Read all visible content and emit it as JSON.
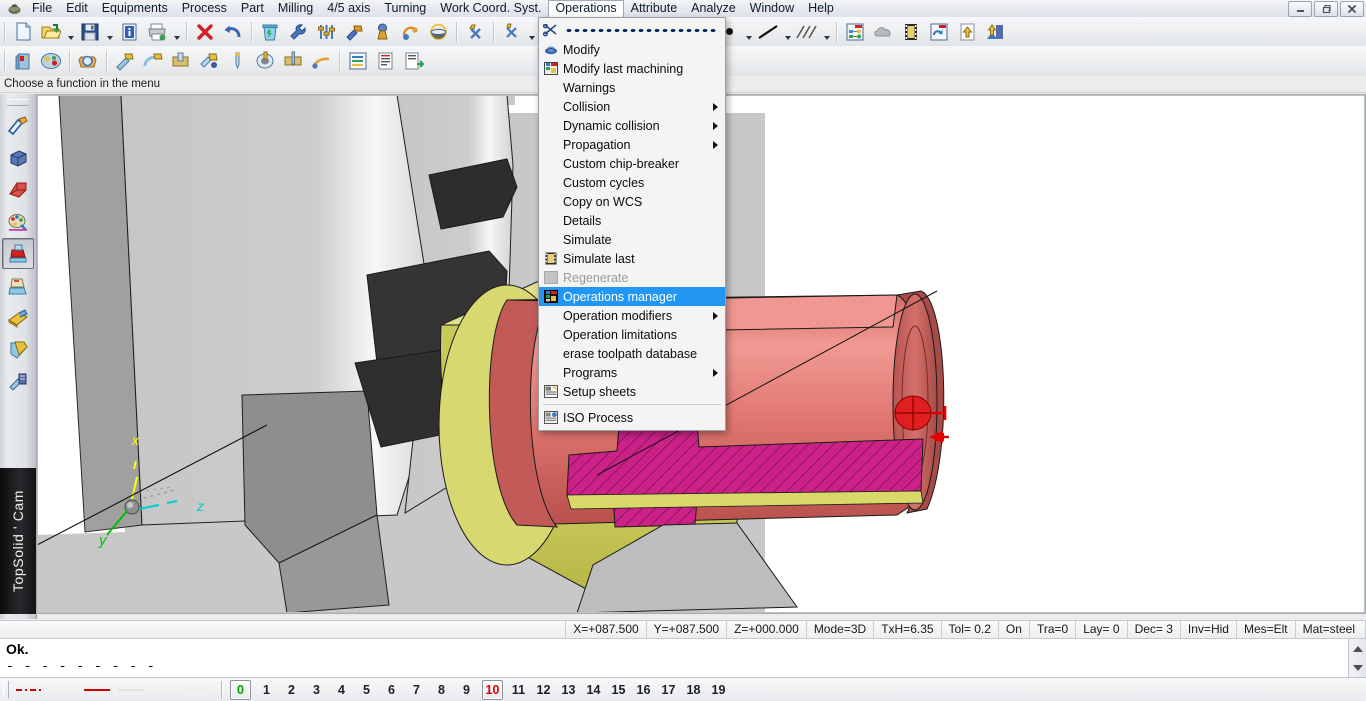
{
  "window": {
    "app_icon": "topsolid-app-icon",
    "controls": [
      {
        "name": "minimize-button",
        "glyph": "–"
      },
      {
        "name": "restore-button",
        "glyph": "❐"
      },
      {
        "name": "close-button",
        "glyph": "✕"
      }
    ]
  },
  "menubar": {
    "items": [
      {
        "label": "File",
        "open": false
      },
      {
        "label": "Edit",
        "open": false
      },
      {
        "label": "Equipments",
        "open": false
      },
      {
        "label": "Process",
        "open": false
      },
      {
        "label": "Part",
        "open": false
      },
      {
        "label": "Milling",
        "open": false
      },
      {
        "label": "4/5 axis",
        "open": false
      },
      {
        "label": "Turning",
        "open": false
      },
      {
        "label": "Work Coord. Syst.",
        "open": false
      },
      {
        "label": "Operations",
        "open": true
      },
      {
        "label": "Attribute",
        "open": false
      },
      {
        "label": "Analyze",
        "open": false
      },
      {
        "label": "Window",
        "open": false
      },
      {
        "label": "Help",
        "open": false
      }
    ]
  },
  "dropdown": {
    "owner": "Operations",
    "tearoff": "scissors-tearoff",
    "items": [
      {
        "label": "Modify",
        "icon": "modify-icon",
        "submenu": false,
        "disabled": false,
        "highlighted": false
      },
      {
        "label": "Modify last machining",
        "icon": "modify-last-machining-icon",
        "submenu": false,
        "disabled": false,
        "highlighted": false
      },
      {
        "label": "Warnings",
        "icon": "",
        "submenu": false,
        "disabled": false,
        "highlighted": false
      },
      {
        "label": "Collision",
        "icon": "",
        "submenu": true,
        "disabled": false,
        "highlighted": false
      },
      {
        "label": "Dynamic collision",
        "icon": "",
        "submenu": true,
        "disabled": false,
        "highlighted": false
      },
      {
        "label": "Propagation",
        "icon": "",
        "submenu": true,
        "disabled": false,
        "highlighted": false
      },
      {
        "label": "Custom chip-breaker",
        "icon": "",
        "submenu": false,
        "disabled": false,
        "highlighted": false
      },
      {
        "label": "Custom cycles",
        "icon": "",
        "submenu": false,
        "disabled": false,
        "highlighted": false
      },
      {
        "label": "Copy on WCS",
        "icon": "",
        "submenu": false,
        "disabled": false,
        "highlighted": false
      },
      {
        "label": "Details",
        "icon": "",
        "submenu": false,
        "disabled": false,
        "highlighted": false
      },
      {
        "label": "Simulate",
        "icon": "",
        "submenu": false,
        "disabled": false,
        "highlighted": false
      },
      {
        "label": "Simulate last",
        "icon": "simulate-last-icon",
        "submenu": false,
        "disabled": false,
        "highlighted": false
      },
      {
        "label": "Regenerate",
        "icon": "regenerate-icon",
        "submenu": false,
        "disabled": true,
        "highlighted": false
      },
      {
        "label": "Operations manager",
        "icon": "operations-manager-icon",
        "submenu": false,
        "disabled": false,
        "highlighted": true
      },
      {
        "label": "Operation modifiers",
        "icon": "",
        "submenu": true,
        "disabled": false,
        "highlighted": false
      },
      {
        "label": "Operation limitations",
        "icon": "",
        "submenu": false,
        "disabled": false,
        "highlighted": false
      },
      {
        "label": "erase toolpath database",
        "icon": "",
        "submenu": false,
        "disabled": false,
        "highlighted": false
      },
      {
        "label": "Programs",
        "icon": "",
        "submenu": true,
        "disabled": false,
        "highlighted": false
      },
      {
        "label": "Setup sheets",
        "icon": "setup-sheets-icon",
        "submenu": false,
        "disabled": false,
        "highlighted": false
      },
      {
        "label": "ISO Process",
        "icon": "iso-process-icon",
        "submenu": false,
        "disabled": false,
        "highlighted": false
      }
    ],
    "separator_before_index": 19
  },
  "prompt": {
    "text": "Choose a function in the menu"
  },
  "toolbar_top": {
    "buttons": [
      {
        "name": "new-document-icon",
        "has_arrow": false
      },
      {
        "name": "open-folder-icon",
        "has_arrow": true
      },
      {
        "name": "save-icon",
        "has_arrow": true
      },
      {
        "name": "document-info-icon",
        "has_arrow": false
      },
      {
        "name": "print-icon",
        "has_arrow": true
      },
      {
        "name": "delete-icon",
        "has_arrow": false
      },
      {
        "name": "undo-icon",
        "has_arrow": false
      },
      {
        "name": "recycle-bin-icon",
        "has_arrow": false
      },
      {
        "name": "wrench-icon",
        "has_arrow": false
      },
      {
        "name": "parameters-icon",
        "has_arrow": false
      },
      {
        "name": "hammer-icon",
        "has_arrow": false
      },
      {
        "name": "tool-assembly-icon",
        "has_arrow": false
      },
      {
        "name": "machining-cycle-icon",
        "has_arrow": false
      },
      {
        "name": "sphere-view-icon",
        "has_arrow": false
      },
      {
        "name": "analyze-point-icon",
        "has_arrow": false
      },
      {
        "name": "analyze-element-icon",
        "has_arrow": true
      },
      {
        "name": "view-rotate-icon",
        "has_arrow": true
      },
      {
        "name": "camera-view-icon",
        "has_arrow": true
      },
      {
        "name": "glasses-view-icon",
        "has_arrow": true
      },
      {
        "name": "cylinder-view-icon",
        "has_arrow": true
      },
      {
        "name": "color-swatch",
        "has_arrow": true
      },
      {
        "name": "point-style-swatch",
        "has_arrow": true
      },
      {
        "name": "line-style-swatch",
        "has_arrow": true
      },
      {
        "name": "hatch-style-swatch",
        "has_arrow": true
      },
      {
        "name": "tree-manager-icon",
        "has_arrow": false
      },
      {
        "name": "cloud-icon",
        "has_arrow": false
      },
      {
        "name": "film-strip-icon",
        "has_arrow": false
      },
      {
        "name": "document-refresh-icon",
        "has_arrow": false
      },
      {
        "name": "export-up-icon",
        "has_arrow": false
      },
      {
        "name": "import-icon",
        "has_arrow": false
      }
    ]
  },
  "toolbar_second": {
    "buttons": [
      {
        "name": "stock-icon"
      },
      {
        "name": "machine-setup-icon"
      },
      {
        "name": "part-orientation-icon"
      },
      {
        "name": "turning-roughing-icon"
      },
      {
        "name": "turning-finishing-icon"
      },
      {
        "name": "turning-grooving-icon"
      },
      {
        "name": "turning-threading-icon"
      },
      {
        "name": "drilling-icon"
      },
      {
        "name": "boring-icon"
      },
      {
        "name": "parting-icon"
      },
      {
        "name": "contour-turning-icon"
      },
      {
        "name": "operations-list-icon"
      },
      {
        "name": "nc-program-icon"
      },
      {
        "name": "nc-output-icon"
      }
    ]
  },
  "leftbar": {
    "buttons": [
      {
        "name": "sketch-tool-icon",
        "pressed": false
      },
      {
        "name": "solid-tool-icon",
        "pressed": false
      },
      {
        "name": "surface-tool-icon",
        "pressed": false
      },
      {
        "name": "attribute-palette-icon",
        "pressed": false
      },
      {
        "name": "machining-tool-icon",
        "pressed": true
      },
      {
        "name": "stock-part-icon",
        "pressed": false
      },
      {
        "name": "assembly-icon",
        "pressed": false
      },
      {
        "name": "document-stack-icon",
        "pressed": false
      },
      {
        "name": "simulation-icon",
        "pressed": false
      }
    ],
    "brand": "TopSolid ' Cam"
  },
  "viewport": {
    "wcs_axes": [
      {
        "label": "x",
        "color": "#ffff00"
      },
      {
        "label": "y",
        "color": "#00c000"
      },
      {
        "label": "z",
        "color": "#00cccc"
      }
    ],
    "colors": {
      "stock_red": "#e0736f",
      "part_yellow": "#d9d96a",
      "section_magenta": "#cc2288",
      "chuck_gray": "#c0c0c0",
      "jaw_dark": "#3a3a3a",
      "background": "#c8c8c8",
      "tool_marker_red": "#e00000",
      "highlight_yellow": "#ffff00"
    }
  },
  "statusbar": {
    "cells": [
      {
        "name": "coord-x",
        "text": "X=+087.500"
      },
      {
        "name": "coord-y",
        "text": "Y=+087.500"
      },
      {
        "name": "coord-z",
        "text": "Z=+000.000"
      },
      {
        "name": "mode",
        "text": "Mode=3D"
      },
      {
        "name": "text-height",
        "text": "TxH=6.35"
      },
      {
        "name": "tolerance",
        "text": "Tol=  0.2"
      },
      {
        "name": "grid-state",
        "text": "On"
      },
      {
        "name": "transparency",
        "text": "Tra=0"
      },
      {
        "name": "layer",
        "text": "Lay=  0"
      },
      {
        "name": "decimals",
        "text": "Dec= 3"
      },
      {
        "name": "invisible",
        "text": "Inv=Hid"
      },
      {
        "name": "measure",
        "text": "Mes=Elt"
      },
      {
        "name": "material",
        "text": "Mat=steel"
      }
    ]
  },
  "message_area": {
    "line1": "Ok.",
    "line2": "- - - - - - - - -"
  },
  "layerbar": {
    "linestyles": [
      {
        "name": "linestyle-dashdot",
        "color": "#cc0000",
        "pattern": "dashdot"
      },
      {
        "name": "linestyle-blank",
        "color": "#f0f0f0",
        "pattern": "solid"
      },
      {
        "name": "linestyle-solid-red",
        "color": "#cc0000",
        "pattern": "solid"
      },
      {
        "name": "linestyle-light-1",
        "color": "#e2e2e2",
        "pattern": "solid"
      },
      {
        "name": "linestyle-light-2",
        "color": "#f2f2f2",
        "pattern": "solid"
      },
      {
        "name": "linestyle-light-3",
        "color": "#ededed",
        "pattern": "solid"
      }
    ],
    "layers": [
      {
        "num": "0",
        "state": "green"
      },
      {
        "num": "1",
        "state": "normal"
      },
      {
        "num": "2",
        "state": "normal"
      },
      {
        "num": "3",
        "state": "normal"
      },
      {
        "num": "4",
        "state": "normal"
      },
      {
        "num": "5",
        "state": "normal"
      },
      {
        "num": "6",
        "state": "normal"
      },
      {
        "num": "7",
        "state": "normal"
      },
      {
        "num": "8",
        "state": "normal"
      },
      {
        "num": "9",
        "state": "normal"
      },
      {
        "num": "10",
        "state": "red"
      },
      {
        "num": "11",
        "state": "normal"
      },
      {
        "num": "12",
        "state": "normal"
      },
      {
        "num": "13",
        "state": "normal"
      },
      {
        "num": "14",
        "state": "normal"
      },
      {
        "num": "15",
        "state": "normal"
      },
      {
        "num": "16",
        "state": "normal"
      },
      {
        "num": "17",
        "state": "normal"
      },
      {
        "num": "18",
        "state": "normal"
      },
      {
        "num": "19",
        "state": "normal"
      }
    ]
  }
}
